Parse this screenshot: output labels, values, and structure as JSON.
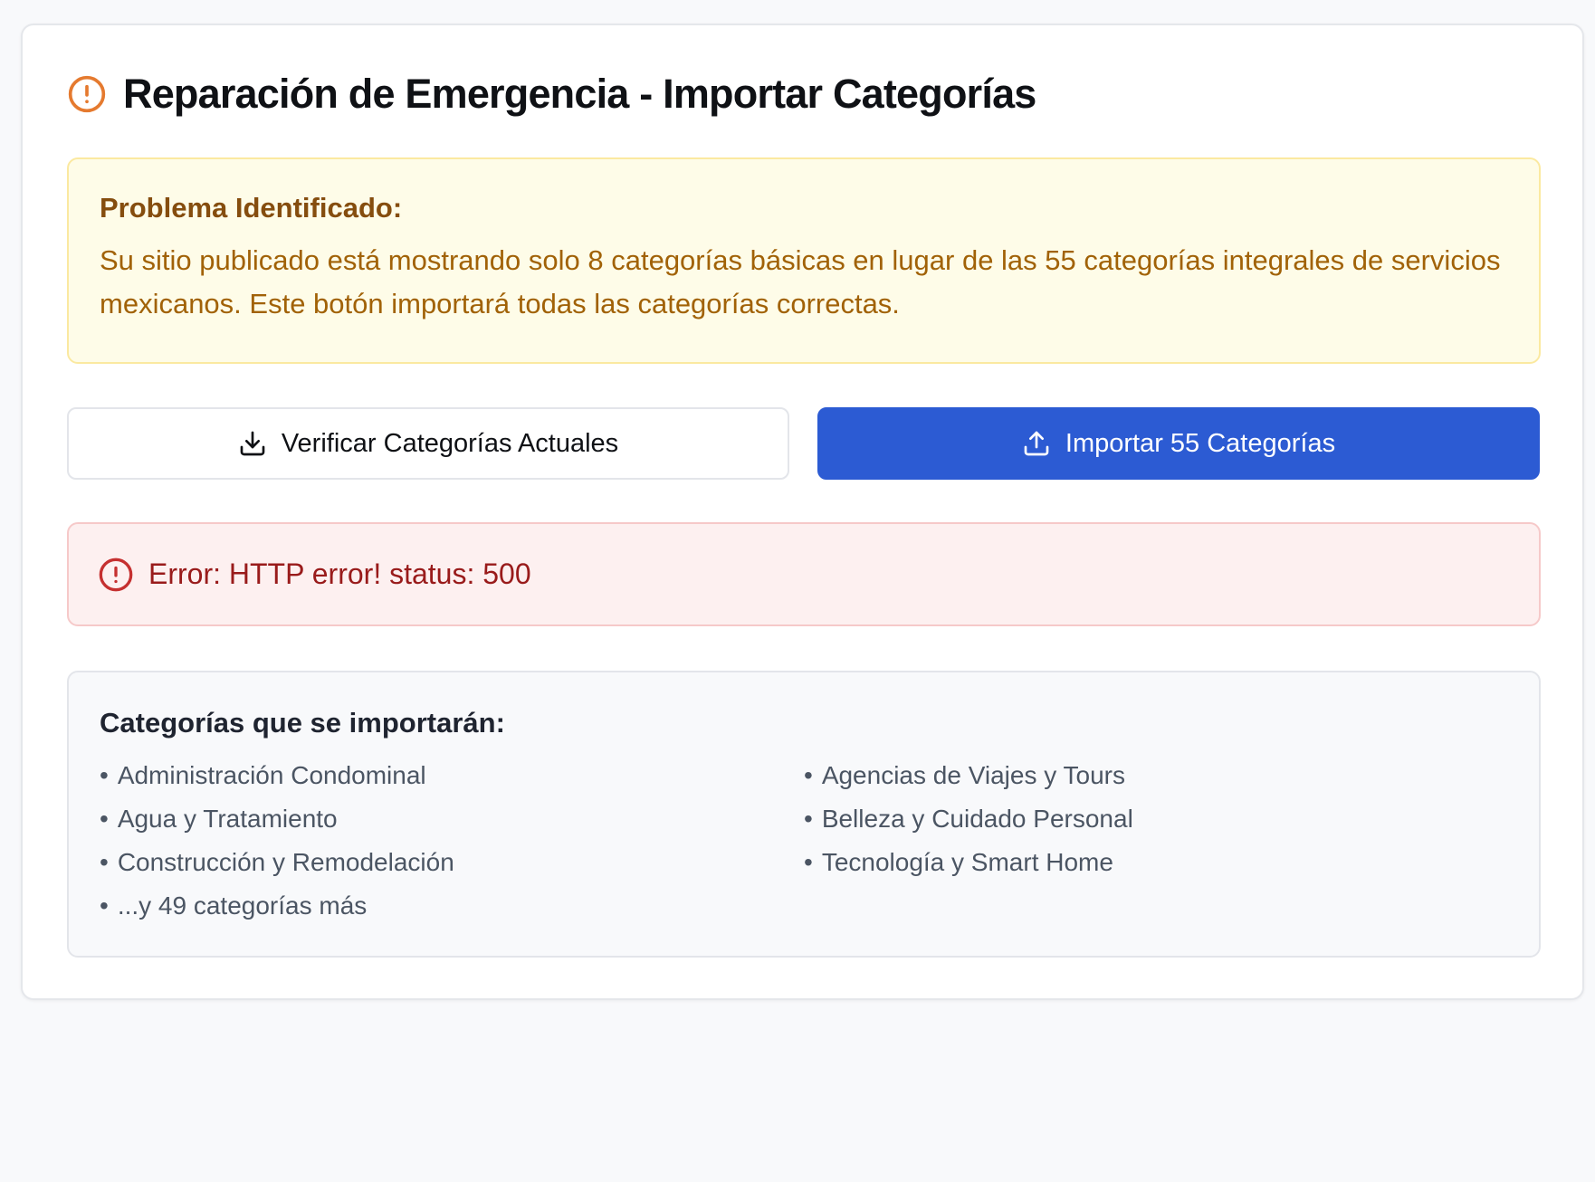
{
  "header": {
    "title": "Reparación de Emergencia - Importar Categorías",
    "icon": "alert-circle-icon",
    "icon_color": "#e57a2f"
  },
  "warning": {
    "title": "Problema Identificado:",
    "text": "Su sitio publicado está mostrando solo 8 categorías básicas en lugar de las 55 categorías integrales de servicios mexicanos. Este botón importará todas las categorías correctas."
  },
  "actions": {
    "verify_label": "Verificar Categorías Actuales",
    "verify_icon": "download-icon",
    "import_label": "Importar 55 Categorías",
    "import_icon": "upload-icon",
    "primary_color": "#2c5bd3"
  },
  "error": {
    "text": "Error: HTTP error! status: 500",
    "icon": "alert-circle-icon",
    "color": "#c53030"
  },
  "categories": {
    "title": "Categorías que se importarán:",
    "bullet": "•",
    "left": [
      "Administración Condominal",
      "Agua y Tratamiento",
      "Construcción y Remodelación",
      "...y 49 categorías más"
    ],
    "right": [
      "Agencias de Viajes y Tours",
      "Belleza y Cuidado Personal",
      "Tecnología y Smart Home"
    ]
  }
}
